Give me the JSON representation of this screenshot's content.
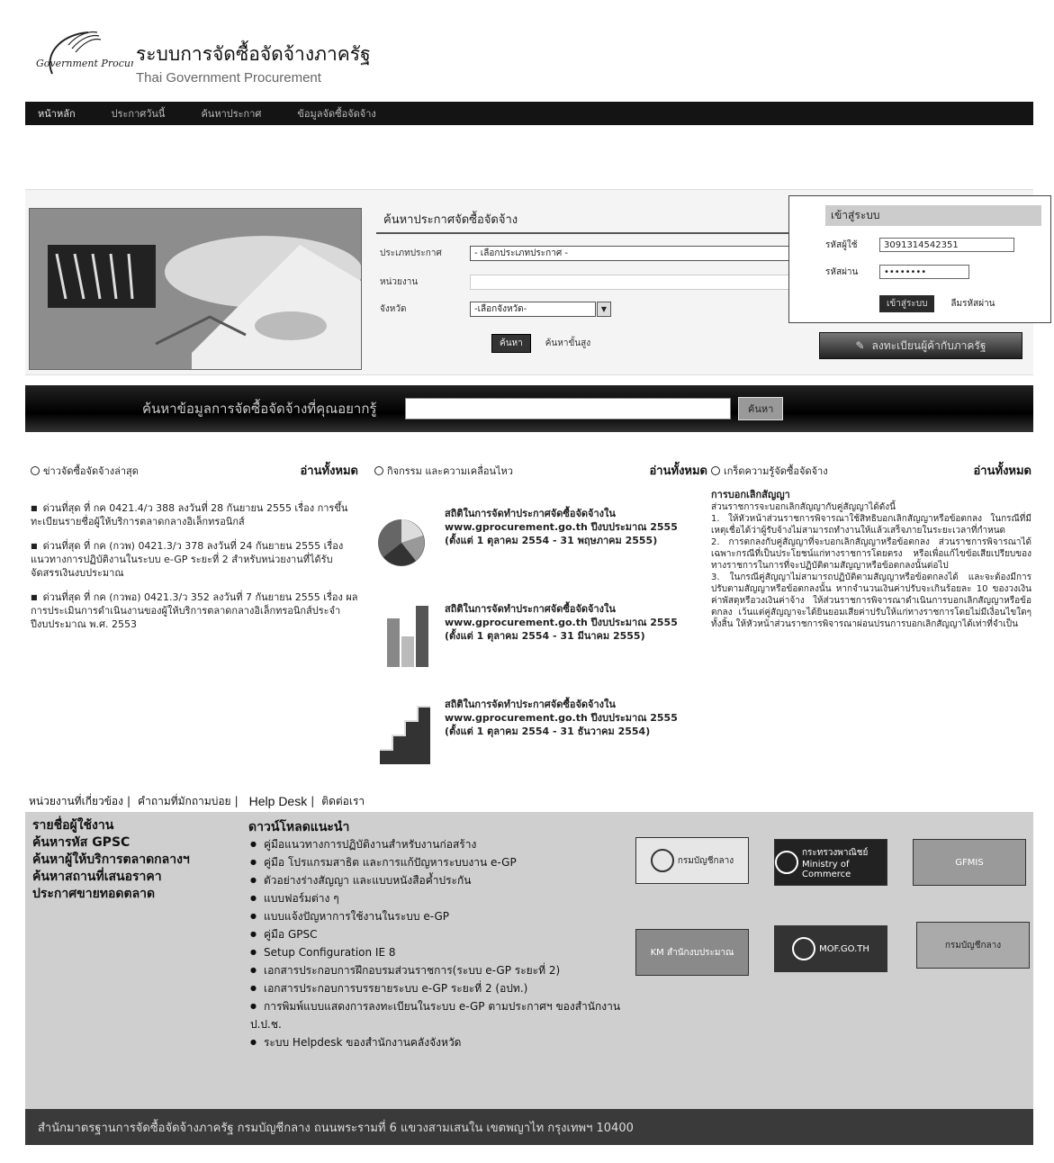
{
  "header": {
    "logo_text": "Government Procurement",
    "title": "ระบบการจัดซื้อจัดจ้างภาครัฐ",
    "subtitle": "Thai Government Procurement"
  },
  "topnav": [
    "หน้าหลัก",
    "ประกาศวันนี้",
    "ค้นหาประกาศ",
    "ข้อมูลจัดซื้อจัดจ้าง"
  ],
  "search": {
    "title": "ค้นหาประกาศจัดซื้อจัดจ้าง",
    "type_label": "ประเภทประกาศ",
    "type_value": "- เลือกประเภทประกาศ -",
    "agency_label": "หน่วยงาน",
    "province_label": "จังหวัด",
    "province_value": "-เลือกจังหวัด-",
    "search_button": "ค้นหา",
    "advanced_link": "ค้นหาขั้นสูง"
  },
  "login": {
    "title": "เข้าสู่ระบบ",
    "user_label": "รหัสผู้ใช้",
    "user_value": "3091314542351",
    "pass_label": "รหัสผ่าน",
    "pass_value": "••••••••",
    "login_button": "เข้าสู่ระบบ",
    "forgot_link": "ลืมรหัสผ่าน"
  },
  "register_button": "ลงทะเบียนผู้ค้ากับภาครัฐ",
  "keyword_search": {
    "label": "ค้นหาข้อมูลการจัดซื้อจัดจ้างที่คุณอยากรู้",
    "button": "ค้นหา"
  },
  "news": {
    "title": "ข่าวจัดซื้อจัดจ้างล่าสุด",
    "more": "อ่านทั้งหมด",
    "items": [
      "ด่วนที่สุด ที่ กค 0421.4/ว 388 ลงวันที่ 28 กันยายน 2555 เรื่อง การขึ้นทะเบียนรายชื่อผู้ให้บริการตลาดกลางอิเล็กทรอนิกส์",
      "ด่วนที่สุด ที่ กค (กวพ) 0421.3/ว 378 ลงวันที่ 24 กันยายน 2555 เรื่อง แนวทางการปฏิบัติงานในระบบ e-GP ระยะที่ 2 สำหรับหน่วยงานที่ได้รับจัดสรรเงินงบประมาณ",
      "ด่วนที่สุด ที่ กค (กวพอ) 0421.3/ว 352 ลงวันที่ 7 กันยายน 2555 เรื่อง ผลการประเมินการดำเนินงานของผู้ให้บริการตลาดกลางอิเล็กทรอนิกส์ประจำปีงบประมาณ พ.ศ. 2553"
    ]
  },
  "activities": {
    "title": "กิจกรรม และความเคลื่อนไหว",
    "more": "อ่านทั้งหมด",
    "items": [
      "สถิติในการจัดทำประกาศจัดซื้อจัดจ้างใน www.gprocurement.go.th ปีงบประมาณ 2555 (ตั้งแต่ 1 ตุลาคม 2554 - 31 พฤษภาคม 2555)",
      "สถิติในการจัดทำประกาศจัดซื้อจัดจ้างใน www.gprocurement.go.th ปีงบประมาณ 2555 (ตั้งแต่ 1 ตุลาคม 2554 - 31 มีนาคม 2555)",
      "สถิติในการจัดทำประกาศจัดซื้อจัดจ้างใน www.gprocurement.go.th ปีงบประมาณ 2555 (ตั้งแต่ 1 ตุลาคม 2554 - 31 ธันวาคม 2554)"
    ]
  },
  "knowledge": {
    "title": "เกร็ดความรู้จัดซื้อจัดจ้าง",
    "more": "อ่านทั้งหมด",
    "article_title": "การบอกเลิกสัญญา",
    "article_body": "ส่วนราชการจะบอกเลิกสัญญากับคู่สัญญาได้ดังนี้\n      1. ให้หัวหน้าส่วนราชการพิจารณาใช้สิทธิบอกเลิกสัญญาหรือข้อตกลง ในกรณีที่มีเหตุเชื่อได้ว่าผู้รับจ้างไม่สามารถทำงานให้แล้วเสร็จภายในระยะเวลาที่กำหนด\n      2. การตกลงกับคู่สัญญาที่จะบอกเลิกสัญญาหรือข้อตกลง ส่วนราชการพิจารณาได้เฉพาะกรณีที่เป็นประโยชน์แก่ทางราชการโดยตรง หรือเพื่อแก้ไขข้อเสียเปรียบของทางราชการในการที่จะปฏิบัติตามสัญญาหรือข้อตกลงนั้นต่อไป\n      3. ในกรณีคู่สัญญาไม่สามารถปฏิบัติตามสัญญาหรือข้อตกลงได้ และจะต้องมีการปรับตามสัญญาหรือข้อตกลงนั้น หากจำนวนเงินค่าปรับจะเกินร้อยละ 10 ของวงเงินค่าพัสดุหรือวงเงินค่าจ้าง ให้ส่วนราชการพิจารณาดำเนินการบอกเลิกสัญญาหรือข้อตกลง เว้นแต่คู่สัญญาจะได้ยินยอมเสียค่าปรับให้แก่ทางราชการโดยไม่มีเงื่อนไขใดๆ ทั้งสิ้น ให้หัวหน้าส่วนราชการพิจารณาผ่อนปรนการบอกเลิกสัญญาได้เท่าที่จำเป็น"
  },
  "footer": {
    "links": [
      "หน่วยงานที่เกี่ยวข้อง",
      "คำถามที่มักถามบ่อย",
      "Help Desk",
      "ติดต่อเรา"
    ],
    "left_links": [
      "รายชื่อผู้ใช้งาน",
      "ค้นหารหัส GPSC",
      "ค้นหาผู้ให้บริการตลาดกลางฯ",
      "ค้นหาสถานที่เสนอราคา",
      "ประกาศขายทอดตลาด"
    ],
    "download_title": "ดาวน์โหลดแนะนำ",
    "downloads": [
      "คู่มือแนวทางการปฏิบัติงานสำหรับงานก่อสร้าง",
      "คู่มือ โปรแกรมสาธิต และการแก้ปัญหาระบบงาน e-GP",
      "ตัวอย่างร่างสัญญา และแบบหนังสือค้ำประกัน",
      "แบบฟอร์มต่าง ๆ",
      "แบบแจ้งปัญหาการใช้งานในระบบ e-GP",
      "คู่มือ GPSC",
      "Setup Configuration IE 8",
      "เอกสารประกอบการฝึกอบรมส่วนราชการ(ระบบ e-GP ระยะที่ 2)",
      "เอกสารประกอบการบรรยายระบบ e-GP ระยะที่ 2 (อปท.)",
      "การพิมพ์แบบแสดงการลงทะเบียนในระบบ e-GP ตามประกาศฯ ของสำนักงาน ป.ป.ช.",
      "ระบบ Helpdesk ของสำนักงานคลังจังหวัด"
    ],
    "banners": [
      "กรมบัญชีกลาง",
      "กระทรวงพาณิชย์ Ministry of Commerce",
      "GFMIS",
      "KM สำนักงบประมาณ",
      "MOF.GO.TH",
      "กรมบัญชีกลาง"
    ],
    "address": "สำนักมาตรฐานการจัดซื้อจัดจ้างภาครัฐ กรมบัญชีกลาง ถนนพระรามที่ 6 แขวงสามเสนใน เขตพญาไท กรุงเทพฯ 10400"
  }
}
